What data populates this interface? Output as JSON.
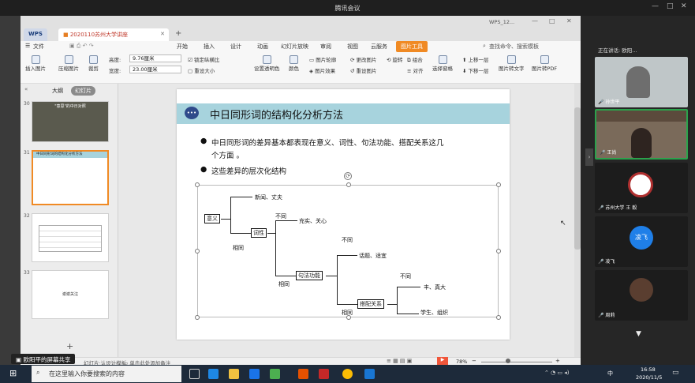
{
  "meeting": {
    "title": "腾讯会议"
  },
  "wps": {
    "logo": "WPS",
    "doc_tab": "2020110苏州大学讲座",
    "right_badge": "WPS_12...",
    "menu": "文件",
    "ribbon_tabs": [
      "开始",
      "插入",
      "设计",
      "动画",
      "幻灯片放映",
      "审阅",
      "视图",
      "云服务",
      "图片工具"
    ],
    "search_hint": "查找命令、搜索模板",
    "tools": {
      "insert_pic": "插入图片",
      "compress": "压缩图片",
      "crop": "裁剪",
      "height_label": "高度:",
      "height_value": "9.76厘米",
      "width_label": "宽度:",
      "width_value": "23.00厘米",
      "lock_ratio": "锁定纵横比",
      "reset_size": "重设大小",
      "set_transparent": "设置透明色",
      "color": "颜色",
      "outline": "图片轮廓",
      "effect": "图片效果",
      "change_pic": "更改图片",
      "reset_pic": "重设图片",
      "rotate": "旋转",
      "align": "对齐",
      "combine": "组合",
      "selection": "选择窗格",
      "up_layer": "上移一层",
      "down_layer": "下移一层",
      "pic_to_text": "图片转文字",
      "pic_to_pdf": "图片转PDF"
    },
    "panel_tabs": [
      "大纲",
      "幻灯片"
    ],
    "thumbs": [
      {
        "num": "30",
        "title": "\"意思\"的中日对照"
      },
      {
        "num": "31",
        "title": "中日同形词的结构化分析方法"
      },
      {
        "num": "32",
        "title": ""
      },
      {
        "num": "33",
        "title": "谢谢关注"
      }
    ],
    "status": {
      "notes": "单击此处添加备注",
      "page_hint": "幻灯片·认设计模板",
      "zoom": "78%"
    }
  },
  "slide": {
    "title": "中日同形词的结构化分析方法",
    "bullet1": "中日同形词的差异基本都表现在意义、词性、句法功能、搭配关系这几",
    "bullet1b": "个方面 。",
    "bullet2": "这些差异的层次化结构",
    "diagram": {
      "n_meaning": "意义",
      "n_pos": "词性",
      "n_syntax": "句法功能",
      "n_colloc": "搭配关系",
      "l_new": "新闻、丈夫",
      "l_diff1": "不同",
      "l_same1": "相同",
      "l_full": "充实、关心",
      "l_diff2": "不同",
      "l_same2": "相同",
      "l_topic": "话题、适宜",
      "l_diff3": "不同",
      "l_same3": "相同",
      "l_rich": "丰、真大",
      "l_student": "学生、组织"
    }
  },
  "participants": {
    "header": "正在讲话: 欧阳...",
    "tiles": [
      {
        "name": "孙世平"
      },
      {
        "name": "王尚"
      },
      {
        "name": "苏州大学 王 毅"
      },
      {
        "name": "凌飞",
        "avatar_text": "凌飞"
      },
      {
        "name": "周莉"
      }
    ]
  },
  "share_banner": "欧阳平的屏幕共享",
  "taskbar": {
    "search_placeholder": "在这里输入你要搜索的内容",
    "time": "16:58",
    "date": "2020/11/5",
    "ime": "中"
  },
  "colors": {
    "accent": "#f08a24",
    "slide_header": "#a7d3dd",
    "taskbar": "#1d2a3a",
    "active_speaker": "#2ba24c"
  }
}
